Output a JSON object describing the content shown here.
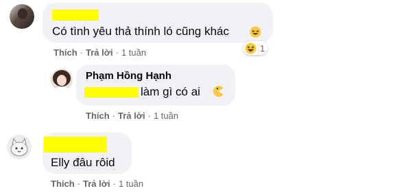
{
  "comments": [
    {
      "author": "",
      "text": "Có tình yêu thả thính ló cũng khác",
      "actions": {
        "like": "Thích",
        "reply": "Trả lời",
        "time": "1 tuần"
      },
      "reaction_count": "1"
    },
    {
      "author": "Phạm Hồng Hạnh",
      "text": "làm gì có ai",
      "actions": {
        "like": "Thích",
        "reply": "Trả lời",
        "time": "1 tuần"
      }
    },
    {
      "author": "",
      "text": "Elly đâu rôid",
      "actions": {
        "like": "Thích",
        "reply": "Trả lời",
        "time": "1 tuần"
      }
    }
  ],
  "colors": {
    "redaction": "#ffff00",
    "bubble": "#f0f2f5",
    "meta": "#65676b"
  }
}
